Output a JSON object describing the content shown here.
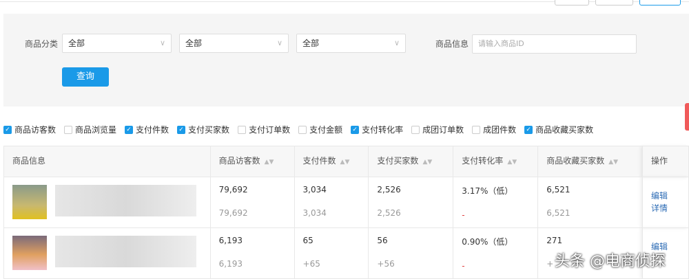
{
  "filter": {
    "category_label": "商品分类",
    "selects": [
      "全部",
      "全部",
      "全部"
    ],
    "info_label": "商品信息",
    "info_placeholder": "请输入商品ID",
    "query_button": "查询"
  },
  "columns_toggle": [
    {
      "label": "商品访客数",
      "checked": true
    },
    {
      "label": "商品浏览量",
      "checked": false
    },
    {
      "label": "支付件数",
      "checked": true
    },
    {
      "label": "支付买家数",
      "checked": true
    },
    {
      "label": "支付订单数",
      "checked": false
    },
    {
      "label": "支付金额",
      "checked": false
    },
    {
      "label": "支付转化率",
      "checked": true
    },
    {
      "label": "成团订单数",
      "checked": false
    },
    {
      "label": "成团件数",
      "checked": false
    },
    {
      "label": "商品收藏买家数",
      "checked": true
    }
  ],
  "table": {
    "headers": [
      "商品信息",
      "商品访客数",
      "支付件数",
      "支付买家数",
      "支付转化率",
      "商品收藏买家数",
      "操作"
    ],
    "rows": [
      {
        "values": [
          "79,692",
          "3,034",
          "2,526",
          "3.17%（低）",
          "6,521"
        ],
        "compare": [
          "79,692",
          "3,034",
          "2,526",
          "-",
          "6,521"
        ],
        "actions": [
          "编辑",
          "详情"
        ]
      },
      {
        "values": [
          "6,193",
          "65",
          "56",
          "0.90%（低）",
          "271"
        ],
        "compare": [
          "6,193",
          "+65",
          "+56",
          "-",
          "+"
        ],
        "actions": [
          "编辑"
        ]
      }
    ]
  },
  "watermark": "头条 @电商侦探"
}
